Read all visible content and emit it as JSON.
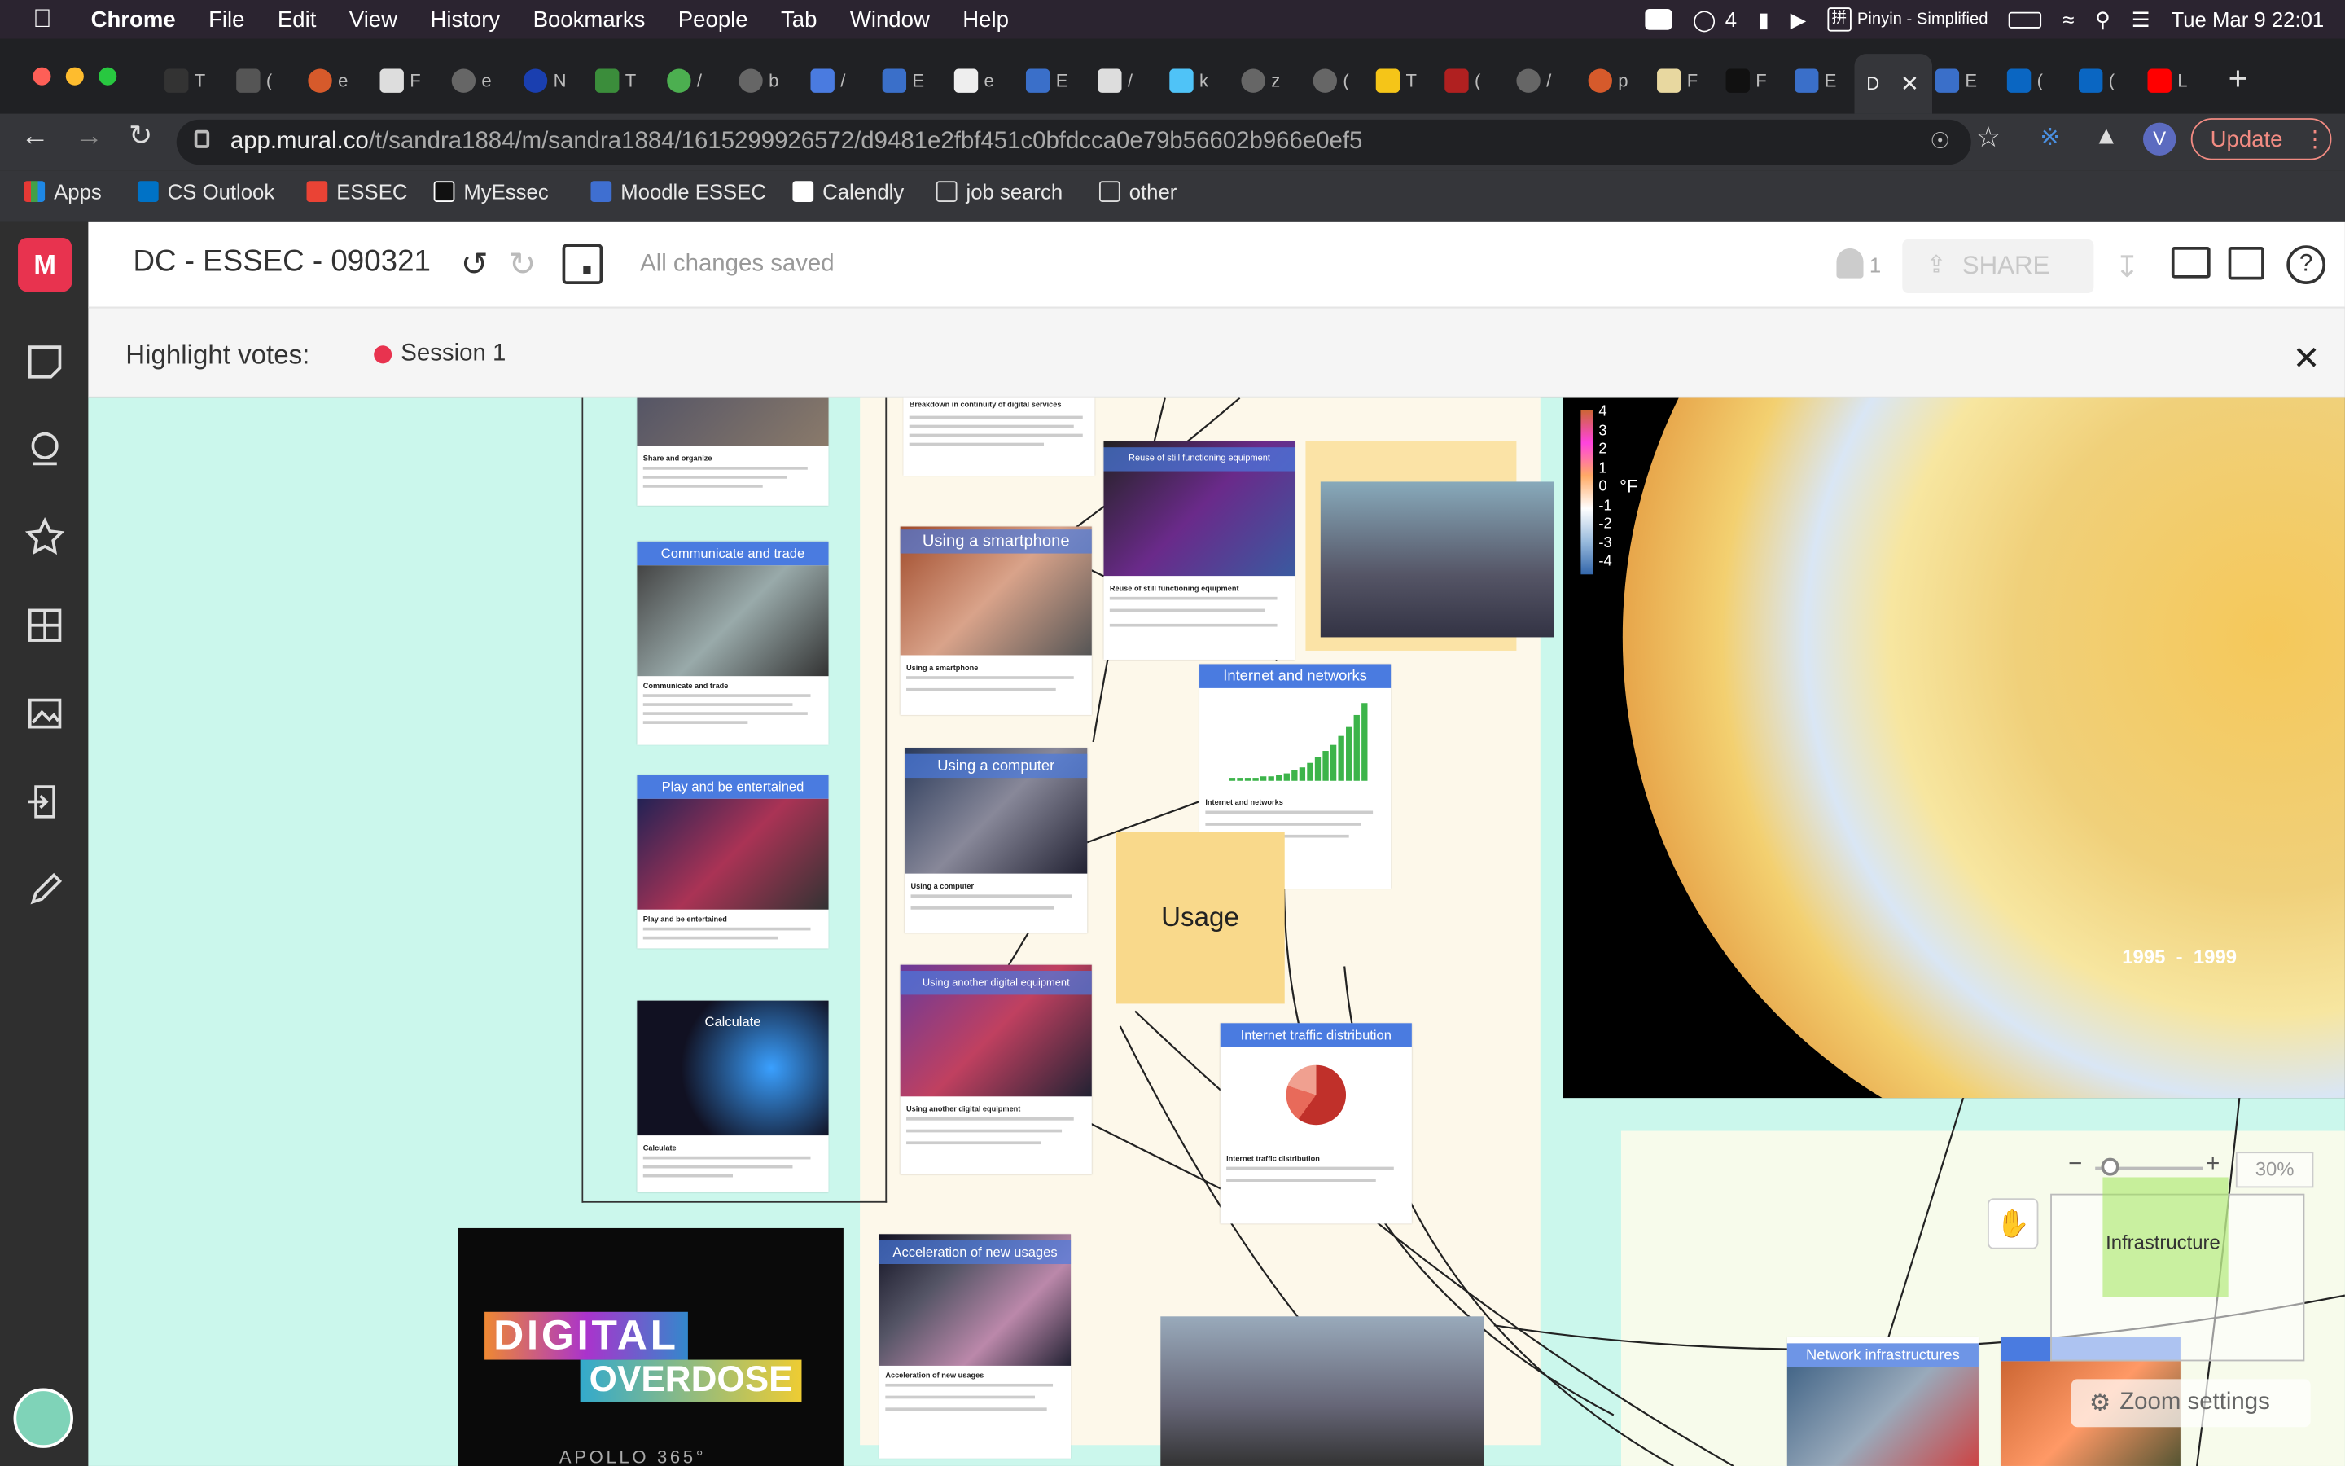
{
  "menubar": {
    "app": "Chrome",
    "items": [
      "File",
      "Edit",
      "View",
      "History",
      "Bookmarks",
      "People",
      "Tab",
      "Window",
      "Help"
    ],
    "wechat_count": "4",
    "pinyin_label": "Pinyin - Simplified",
    "datetime": "Tue Mar 9  22:01"
  },
  "tabs": {
    "active_label": "D"
  },
  "toolbar": {
    "url_host": "app.mural.co",
    "url_path": "/t/sandra1884/m/sandra1884/1615299926572/d9481e2fbf451c0bfdcca0e79b56602b966e0ef5",
    "update_label": "Update",
    "profile_initial": "V"
  },
  "bookmarks": {
    "items": [
      "Apps",
      "CS Outlook",
      "ESSEC",
      "MyEssec",
      "Moodle ESSEC",
      "Calendly",
      "job search",
      "other"
    ]
  },
  "mural": {
    "logo": "M",
    "title": "DC - ESSEC - 090321",
    "save_status": "All changes saved",
    "collaborators": "1",
    "share_label": "SHARE",
    "highlight_label": "Highlight votes:",
    "session_label": "Session 1",
    "zoom_level": "30%",
    "zoom_settings": "Zoom settings",
    "minimap_label": "Infrastructure"
  },
  "board": {
    "cards": [
      {
        "title": "",
        "caption": "Share and organize"
      },
      {
        "title": "Communicate and trade",
        "caption": "Communicate and trade"
      },
      {
        "title": "Play and be entertained",
        "caption": "Play and be entertained"
      },
      {
        "title": "Calculate",
        "caption": "Calculate"
      },
      {
        "title": "",
        "caption": "Breakdown in continuity of digital services"
      },
      {
        "title": "Using a smartphone",
        "caption": "Using a smartphone"
      },
      {
        "title": "Using a computer",
        "caption": "Using a computer"
      },
      {
        "title": "Using another digital equipment",
        "caption": "Using another digital equipment"
      },
      {
        "title": "Reuse of still functioning equipment",
        "caption": "Reuse of still functioning equipment"
      },
      {
        "title": "Internet and networks",
        "caption": "Internet and networks"
      },
      {
        "title": "Internet traffic distribution",
        "caption": "Internet traffic distribution"
      },
      {
        "title": "Acceleration of new usages",
        "caption": "Acceleration of new usages"
      },
      {
        "title": "Network infrastructures",
        "caption": ""
      }
    ],
    "usage_label": "Usage",
    "digital_overdose_1": "DIGITAL",
    "digital_overdose_2": "OVERDOSE",
    "apollo": "APOLLO 365°",
    "map_year": "1995  -  1999",
    "map_unit": "°F",
    "map_scale": [
      "4",
      "3",
      "2",
      "1",
      "0",
      "-1",
      "-2",
      "-3",
      "-4"
    ]
  },
  "colors": {
    "accent": "#e8334f",
    "canvas": "#cbf7ec",
    "card_header": "#4a7be0",
    "sticky": "#f9d98b"
  }
}
